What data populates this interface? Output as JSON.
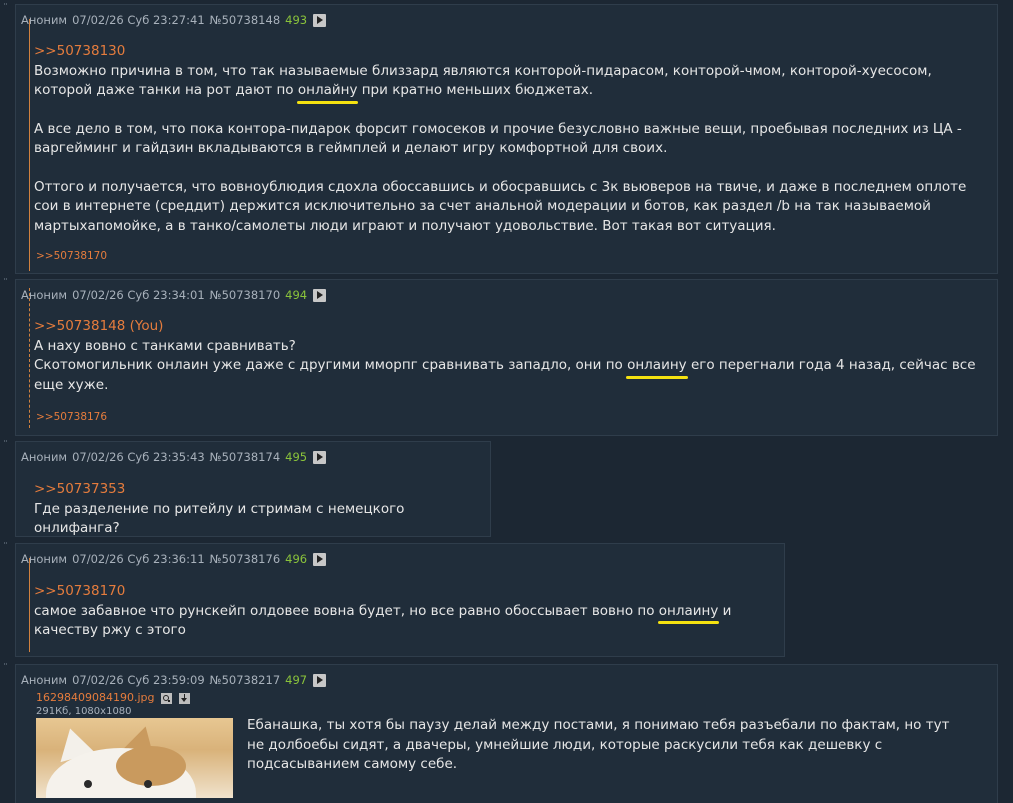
{
  "dots": "¨",
  "posts": [
    {
      "author": "Аноним",
      "date": "07/02/26 Суб 23:27:41",
      "id": "№50738148",
      "num": "493",
      "quote": ">>50738130",
      "lines": [
        {
          "pre": "Возможно причина в том, что так называемые близзард являются конторой-пидарасом, конторой-чмом, конторой-хуесосом, которой даже танки на рот дают по ",
          "hl": "онлайну",
          "post": " при кратно меньших бюджетах."
        },
        {
          "text": "А все дело в том, что пока контора-пидарок форсит гомосеков и прочие безусловно важные вещи, проебывая последних из ЦА - варгейминг и гайдзин вкладываются в геймплей и делают игру комфортной для своих."
        },
        {
          "text": "Оттого и получается, что вовноублюдия сдохла обоссавшись и обосравшись с 3к вьюверов на твиче, и даже в последнем оплоте сои в интернете (среддит) держится исключительно за счет анальной модерации и ботов, как раздел /b на так называемой мартыхапомойке, а в танко/самолеты люди играют и получают удовольствие. Вот такая вот ситуация."
        }
      ],
      "backlink": ">>50738170"
    },
    {
      "author": "Аноним",
      "date": "07/02/26 Суб 23:34:01",
      "id": "№50738170",
      "num": "494",
      "quote": ">>50738148 (You)",
      "line1": "А наху вовно с танками сравнивать?",
      "line2_pre": "Скотомогильник онлаин уже даже с другими мморпг сравнивать западло, они по ",
      "line2_hl": "онлаину",
      "line2_post": " его перегнали года 4 назад, сейчас все еще хуже.",
      "backlink": ">>50738176"
    },
    {
      "author": "Аноним",
      "date": "07/02/26 Суб 23:35:43",
      "id": "№50738174",
      "num": "495",
      "quote": ">>50737353",
      "text": "Где разделение по ритейлу и стримам с немецкого онлифанга?"
    },
    {
      "author": "Аноним",
      "date": "07/02/26 Суб 23:36:11",
      "id": "№50738176",
      "num": "496",
      "quote": ">>50738170",
      "pre": "самое забавное что рунскейп олдовее вовна будет, но все равно обоссывает вовно по ",
      "hl": "онлаину",
      "post": " и качеству ржу с этого"
    },
    {
      "author": "Аноним",
      "date": "07/02/26 Суб 23:59:09",
      "id": "№50738217",
      "num": "497",
      "filename": "16298409084190.jpg",
      "filemeta": "291Кб, 1080x1080",
      "text": "Ебанашка, ты хотя бы паузу делай между постами, я понимаю тебя разъебали по фактам, но тут не долбоебы сидят, а двачеры, умнейшие люди, которые раскусили тебя как дешевку с подсасыванием самому себе."
    }
  ]
}
